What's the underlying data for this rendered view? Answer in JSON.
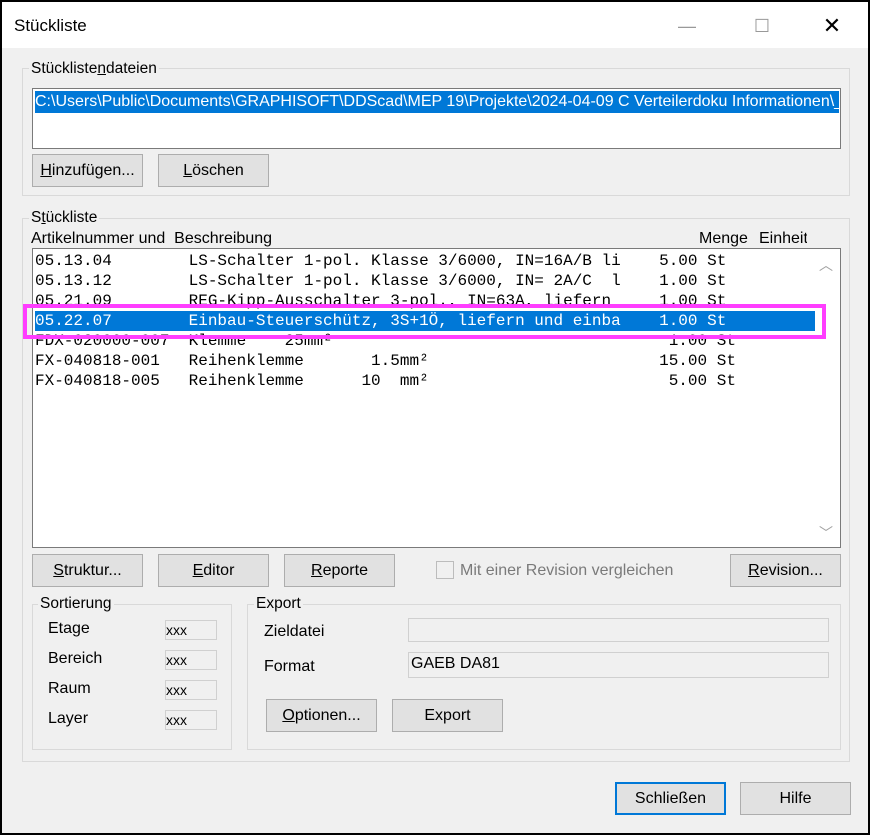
{
  "window": {
    "title": "Stückliste",
    "min_symbol": "—",
    "max_symbol": "☐",
    "close_symbol": "✕"
  },
  "files_group": {
    "label_prefix": "Stückliste",
    "label_underlined": "n",
    "label_suffix": "dateien",
    "selected_path": "C:\\Users\\Public\\Documents\\GRAPHISOFT\\DDScad\\MEP 19\\Projekte\\2024-04-09 C Verteilerdoku Informationen\\_",
    "add_button": {
      "underlined": "H",
      "rest": "inzufügen..."
    },
    "delete_button": {
      "underlined": "L",
      "rest": "öschen"
    }
  },
  "list_group": {
    "label_prefix": "S",
    "label_underlined": "t",
    "label_suffix": "ückliste",
    "columns": {
      "article_and_desc": "Artikelnummer und  Beschreibung",
      "quantity": "Menge",
      "unit": "Einheit"
    },
    "rows": [
      {
        "text": "05.13.04        LS-Schalter 1-pol. Klasse 3/6000, IN=16A/B li    5.00 St",
        "selected": false
      },
      {
        "text": "05.13.12        LS-Schalter 1-pol. Klasse 3/6000, IN= 2A/C  l    1.00 St",
        "selected": false
      },
      {
        "text": "05.21.09        REG-Kipp-Ausschalter 3-pol., IN=63A, liefern     1.00 St",
        "selected": false
      },
      {
        "text": "05.22.07        Einbau-Steuerschütz, 3S+1Ö, liefern und einba    1.00 St",
        "selected": true
      },
      {
        "text": "FDX-020000-007  Klemme    25mm²                                   1.00 St",
        "selected": false
      },
      {
        "text": "FX-040818-001   Reihenklemme       1.5mm²                        15.00 St",
        "selected": false
      },
      {
        "text": "FX-040818-005   Reihenklemme      10  mm²                         5.00 St",
        "selected": false
      }
    ],
    "scroll_up_symbol": "︿",
    "scroll_down_symbol": "﹀",
    "structure_button": {
      "underlined": "S",
      "rest": "truktur..."
    },
    "editor_button": {
      "underlined": "E",
      "rest": "ditor"
    },
    "reports_button": {
      "underlined": "R",
      "rest": "eporte"
    },
    "compare_checkbox_label": "Mit einer Revision vergleichen",
    "compare_checked": false,
    "revision_button": {
      "underlined": "R",
      "rest": "evision..."
    }
  },
  "sort_group": {
    "label": "Sortierung",
    "items": [
      {
        "label": "Etage",
        "value": "xxx"
      },
      {
        "label": "Bereich",
        "value": "xxx"
      },
      {
        "label": "Raum",
        "value": "xxx"
      },
      {
        "label": "Layer",
        "value": "xxx"
      }
    ]
  },
  "export_group": {
    "label": "Export",
    "target_file_label": "Zieldatei",
    "target_file_value": "",
    "format_label": "Format",
    "format_value": "GAEB DA81",
    "options_button": {
      "underlined": "O",
      "rest": "ptionen..."
    },
    "export_button": "Export"
  },
  "footer": {
    "close_button": "Schließen",
    "help_button": "Hilfe"
  },
  "colors": {
    "selection": "#0078d7",
    "highlight_frame": "#ff3dff"
  }
}
